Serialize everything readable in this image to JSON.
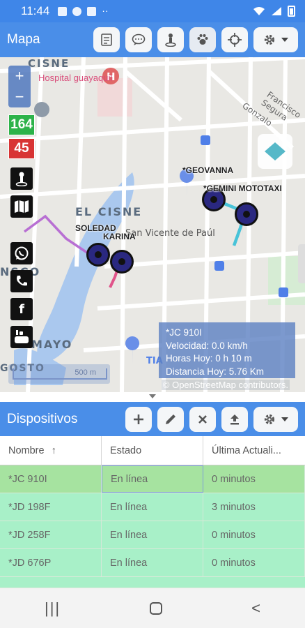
{
  "status_bar": {
    "time": "11:44",
    "dots": "··"
  },
  "map_panel": {
    "title": "Mapa",
    "buttons": [
      "report-icon",
      "chat-icon",
      "person-pin-icon",
      "paw-icon",
      "crosshair-icon",
      "gear-icon"
    ],
    "zoom_in": "+",
    "zoom_out": "−",
    "count_green": "164",
    "count_red": "45",
    "labels": {
      "cisne_top": "CISNE",
      "hospital": "Hospital guayaquil",
      "el_cisne": "EL CISNE",
      "vicente": "San Vicente de Paúl",
      "nsco": "NSCO",
      "mayo": "MAYO",
      "gosto": "GOSTO",
      "francisco": "Francisco Segura",
      "gonzalo": "Gonzalo",
      "tia": "TIA"
    },
    "markers": [
      "*GEOVANNA",
      "*GEMINI MOTOTAXI",
      "SOLEDAD",
      "KARINA"
    ],
    "info": {
      "plate": "*JC 910I",
      "speed": "Velocidad: 0.0 km/h",
      "hours": "Horas Hoy: 0 h 10 m",
      "distance": "Distancia Hoy: 5.76 Km"
    },
    "scale": "500 m",
    "attribution": "© OpenStreetMap contributors."
  },
  "devices_panel": {
    "title": "Dispositivos",
    "buttons": [
      "plus-icon",
      "pencil-icon",
      "close-icon",
      "upload-icon",
      "gear-icon"
    ],
    "columns": [
      "Nombre",
      "Estado",
      "Última Actuali..."
    ],
    "sort_indicator": "↑",
    "rows": [
      {
        "name": "*JC 910I",
        "status": "En línea",
        "last": "0 minutos"
      },
      {
        "name": "*JD 198F",
        "status": "En línea",
        "last": "3 minutos"
      },
      {
        "name": "*JD 258F",
        "status": "En línea",
        "last": "0 minutos"
      },
      {
        "name": "*JD 676P",
        "status": "En línea",
        "last": "0 minutos"
      }
    ]
  },
  "nav_bar": {
    "recent": "|||",
    "back": "<"
  },
  "colors": {
    "accent": "#4a8ee8",
    "row_selected": "#a6e3a0",
    "row_normal": "#a8f0c8",
    "count_green": "#2db34a",
    "count_red": "#d83434",
    "marker": "#2a2880"
  }
}
